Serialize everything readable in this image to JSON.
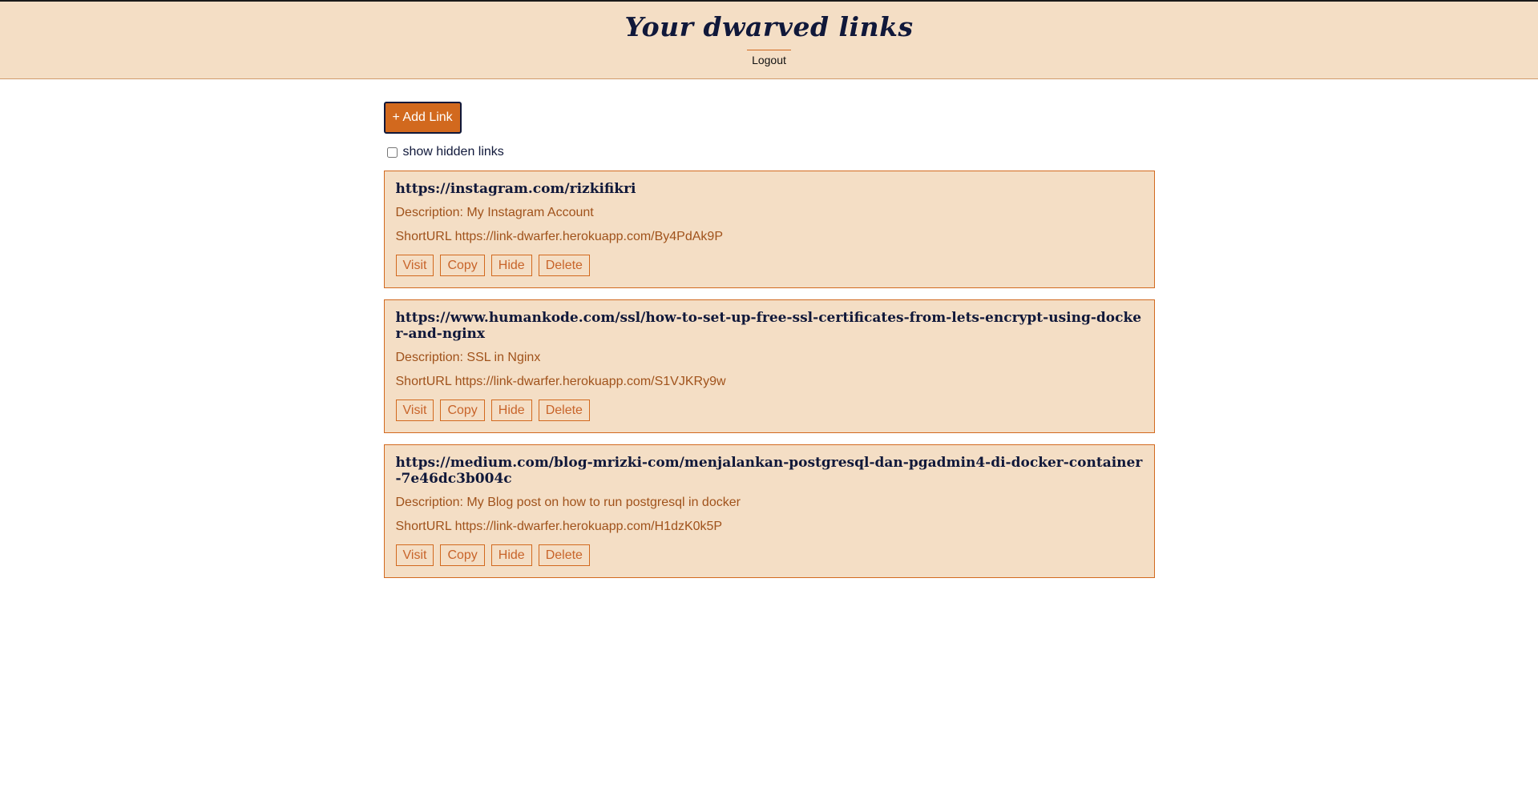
{
  "header": {
    "title": "Your dwarved links",
    "logout_label": "Logout"
  },
  "toolbar": {
    "add_label": "+ Add Link",
    "show_hidden_label": "show hidden links",
    "show_hidden_checked": false
  },
  "links": [
    {
      "url": "https://instagram.com/rizkifikri",
      "description": "Description: My Instagram Account",
      "short_url": "ShortURL https://link-dwarfer.herokuapp.com/By4PdAk9P"
    },
    {
      "url": "https://www.humankode.com/ssl/how-to-set-up-free-ssl-certificates-from-lets-encrypt-using-docker-and-nginx",
      "description": "Description: SSL in Nginx",
      "short_url": "ShortURL https://link-dwarfer.herokuapp.com/S1VJKRy9w"
    },
    {
      "url": "https://medium.com/blog-mrizki-com/menjalankan-postgresql-dan-pgadmin4-di-docker-container-7e46dc3b004c",
      "description": "Description: My Blog post on how to run postgresql in docker",
      "short_url": "ShortURL https://link-dwarfer.herokuapp.com/H1dzK0k5P"
    }
  ],
  "actions": {
    "visit": "Visit",
    "copy": "Copy",
    "hide": "Hide",
    "delete": "Delete"
  },
  "colors": {
    "accent": "#d2691e",
    "background": "#f4dec5",
    "text_dark": "#10183a"
  }
}
